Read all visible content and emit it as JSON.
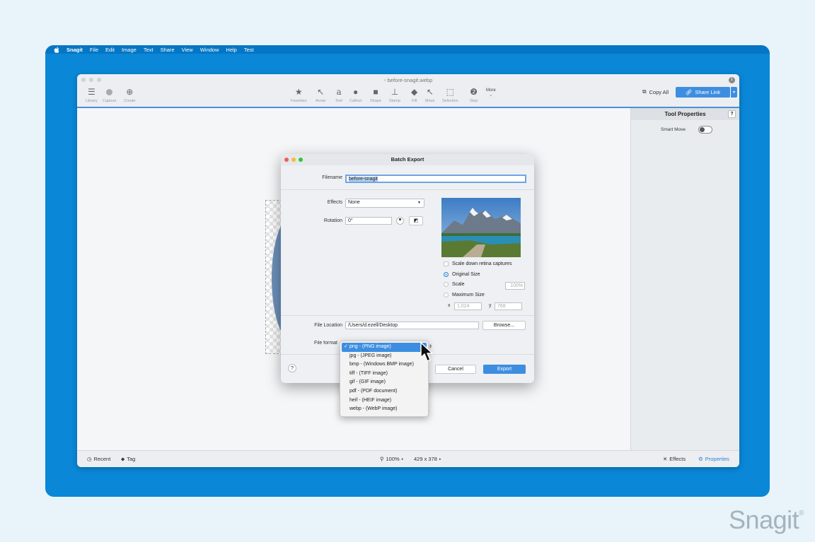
{
  "menubar": {
    "app": "Snagit",
    "items": [
      "File",
      "Edit",
      "Image",
      "Text",
      "Share",
      "View",
      "Window",
      "Help",
      "Test"
    ]
  },
  "window": {
    "title": "before-snagit.webp",
    "left_tools": [
      {
        "label": "Library",
        "icon": "library-icon"
      },
      {
        "label": "Capture",
        "icon": "capture-icon"
      },
      {
        "label": "Create",
        "icon": "create-icon"
      }
    ],
    "tools": [
      {
        "label": "Favorites",
        "icon": "star-icon"
      },
      {
        "label": "Arrow",
        "icon": "arrow-icon"
      },
      {
        "label": "Text",
        "icon": "text-icon"
      },
      {
        "label": "Callout",
        "icon": "callout-icon"
      },
      {
        "label": "Shape",
        "icon": "shape-icon"
      },
      {
        "label": "Stamp",
        "icon": "stamp-icon"
      },
      {
        "label": "Fill",
        "icon": "fill-icon"
      },
      {
        "label": "Move",
        "icon": "move-icon"
      },
      {
        "label": "Selection",
        "icon": "selection-icon"
      },
      {
        "label": "Step",
        "icon": "step-icon"
      }
    ],
    "more_label": "More",
    "copy_all": "Copy All",
    "share_link": "Share Link"
  },
  "panel": {
    "title": "Tool Properties",
    "help": "?",
    "smart_move": "Smart Move"
  },
  "statusbar": {
    "recent": "Recent",
    "tag": "Tag",
    "zoom": "100%",
    "dimensions": "429 x 378",
    "effects": "Effects",
    "properties": "Properties"
  },
  "dialog": {
    "title": "Batch Export",
    "filename_label": "Filename",
    "filename_value": "before-snagit",
    "effects_label": "Effects",
    "effects_value": "None",
    "rotation_label": "Rotation",
    "rotation_value": "0°",
    "scale_down": "Scale down retina captures",
    "original_size": "Original Size",
    "scale": "Scale",
    "scale_value": "100%",
    "max_size": "Maximum Size",
    "x_label": "x",
    "x_value": "1,024",
    "y_label": "y",
    "y_value": "768",
    "file_location_label": "File Location",
    "file_location_value": "/Users/d.ezell/Desktop",
    "browse": "Browse...",
    "file_format_label": "File format",
    "help": "?",
    "cancel": "Cancel",
    "export": "Export"
  },
  "format_options": [
    "png - (PNG image)",
    "jpg - (JPEG image)",
    "bmp - (Windows BMP image)",
    "tiff - (TIFF image)",
    "gif - (GIF image)",
    "pdf - (PDF document)",
    "heif - (HEIF image)",
    "webp - (WebP image)"
  ],
  "format_selected_check": "✓",
  "brand": {
    "logo": "Snagit",
    "mark": "®"
  },
  "colors": {
    "desktop": "#0a87d6",
    "accent": "#3d8ee0",
    "background": "#e9f3fa"
  }
}
